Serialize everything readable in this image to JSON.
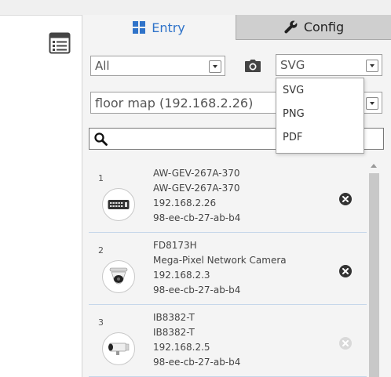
{
  "tabs": {
    "entry_label": "Entry",
    "config_label": "Config"
  },
  "filter": {
    "category_value": "All",
    "format_value": "SVG"
  },
  "format_dropdown": {
    "options": [
      "SVG",
      "PNG",
      "PDF"
    ]
  },
  "map_select": {
    "value": "floor map (192.168.2.26)"
  },
  "search": {
    "value": "",
    "placeholder": ""
  },
  "devices": [
    {
      "index": "1",
      "model": "AW-GEV-267A-370",
      "name": "AW-GEV-267A-370",
      "ip": "192.168.2.26",
      "mac": "98-ee-cb-27-ab-b4",
      "icon": "switch-icon",
      "removable": true
    },
    {
      "index": "2",
      "model": "FD8173H",
      "name": "Mega-Pixel Network Camera",
      "ip": "192.168.2.3",
      "mac": "98-ee-cb-27-ab-b4",
      "icon": "dome-camera-icon",
      "removable": true
    },
    {
      "index": "3",
      "model": "IB8382-T",
      "name": "IB8382-T",
      "ip": "192.168.2.5",
      "mac": "98-ee-cb-27-ab-b4",
      "icon": "bullet-camera-icon",
      "removable": false
    }
  ],
  "colors": {
    "accent": "#2f73c9",
    "delete_active": "#333333",
    "delete_inactive": "#d9d9d9"
  }
}
